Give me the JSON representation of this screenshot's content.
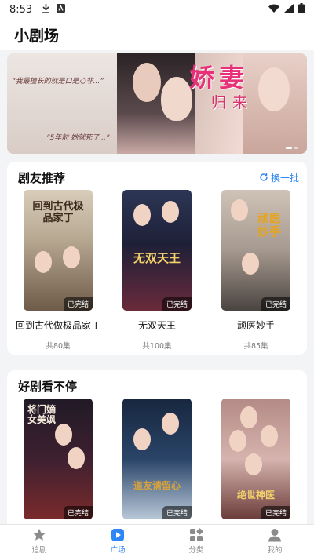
{
  "status": {
    "time": "8:53"
  },
  "appbar": {
    "title": "小剧场"
  },
  "banner": {
    "title": "娇妻",
    "subtitle": "归来",
    "quote1": "“我最擅长的就是口是心非...”",
    "quote2": "“5年前 她就死了...”"
  },
  "section1": {
    "title": "剧友推荐",
    "action": "换一批",
    "items": [
      {
        "name": "回到古代做极品家丁",
        "badge": "已完结",
        "episodes": "共80集",
        "art": "回到古代极品家丁"
      },
      {
        "name": "无双天王",
        "badge": "已完结",
        "episodes": "共100集",
        "art": "无双天王"
      },
      {
        "name": "顽医妙手",
        "badge": "已完结",
        "episodes": "共85集",
        "art": "顽医妙手"
      }
    ]
  },
  "section2": {
    "title": "好剧看不停",
    "items": [
      {
        "badge": "已完结",
        "art": "将门嫡女美飒"
      },
      {
        "badge": "已完结",
        "art": "道友请留心"
      },
      {
        "badge": "已完结",
        "art": "绝世神医"
      }
    ]
  },
  "tabs": [
    {
      "label": "追剧",
      "icon": "star-icon",
      "active": false
    },
    {
      "label": "广场",
      "icon": "play-icon",
      "active": true
    },
    {
      "label": "分类",
      "icon": "grid-icon",
      "active": false
    },
    {
      "label": "我的",
      "icon": "user-icon",
      "active": false
    }
  ],
  "colors": {
    "accent": "#2f86f6",
    "banner_title": "#e8307a"
  }
}
